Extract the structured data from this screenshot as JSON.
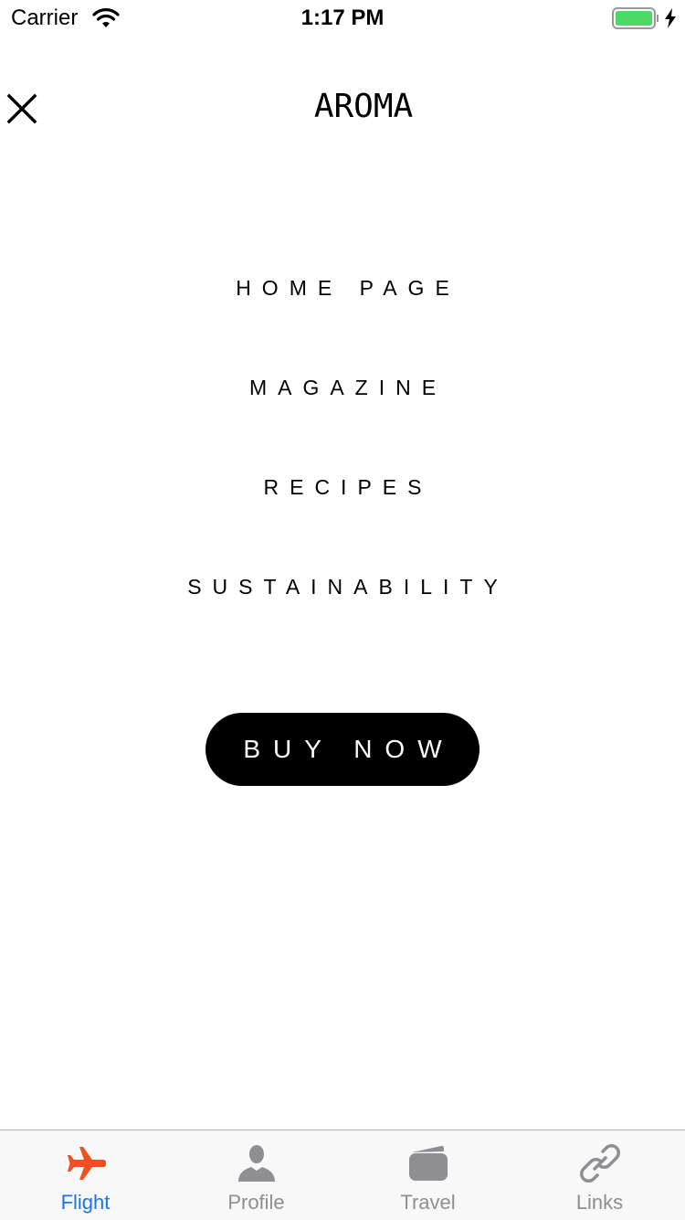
{
  "status_bar": {
    "carrier": "Carrier",
    "time": "1:17 PM"
  },
  "header": {
    "brand": "AROMA"
  },
  "menu": {
    "items": [
      {
        "label": "HOME PAGE"
      },
      {
        "label": "MAGAZINE"
      },
      {
        "label": "RECIPES"
      },
      {
        "label": "SUSTAINABILITY"
      }
    ]
  },
  "buy_button": {
    "label": "BUY NOW"
  },
  "tab_bar": {
    "tabs": [
      {
        "label": "Flight",
        "icon": "airplane-icon",
        "active": true
      },
      {
        "label": "Profile",
        "icon": "person-icon",
        "active": false
      },
      {
        "label": "Travel",
        "icon": "wallet-icon",
        "active": false
      },
      {
        "label": "Links",
        "icon": "link-icon",
        "active": false
      }
    ]
  },
  "colors": {
    "active_tab_text": "#1a73e8",
    "active_tab_icon": "#f04e23",
    "inactive_tab": "#8e8e93",
    "battery": "#4cd964",
    "button_bg": "#000000"
  }
}
